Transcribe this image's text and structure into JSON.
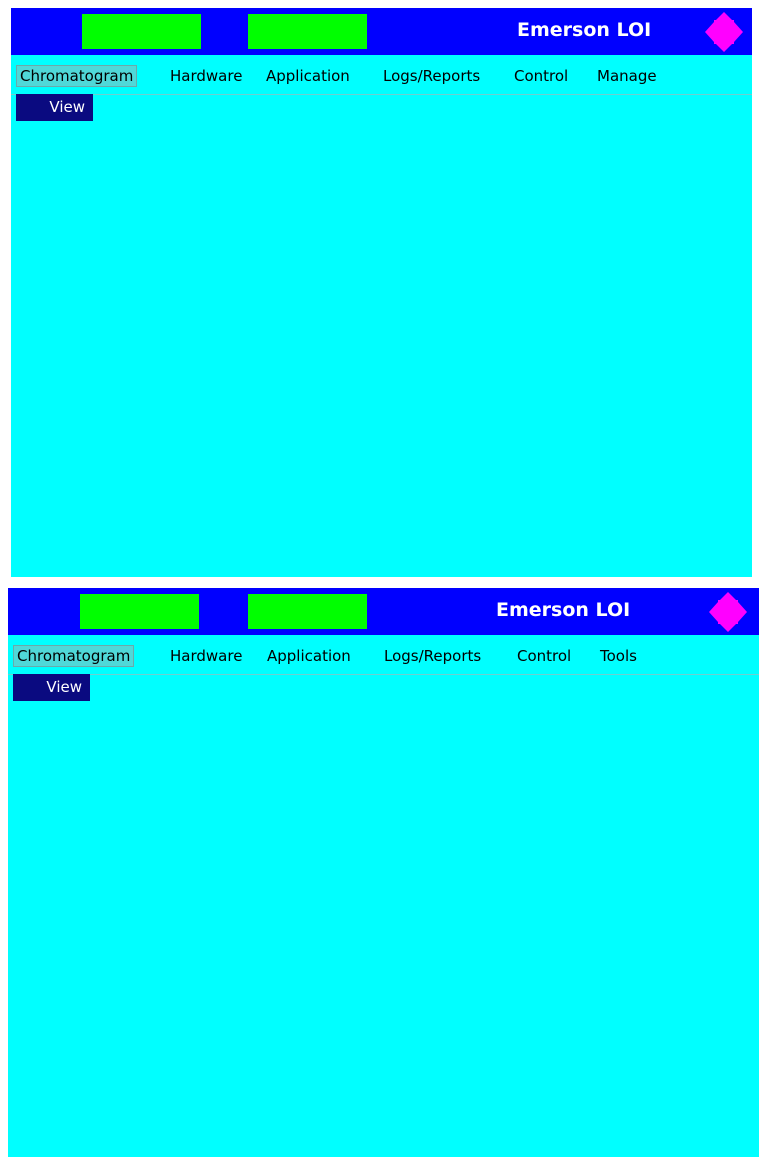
{
  "colors": {
    "background": "#00ffff",
    "titlebar": "#0000ff",
    "indicator": "#00ff00",
    "nav_icon": "#ff00ff",
    "submenu": "#0a0a80"
  },
  "screens": [
    {
      "title": "Emerson LOI",
      "menu": [
        "Chromatogram",
        "Hardware",
        "Application",
        "Logs/Reports",
        "Control",
        "Manage"
      ],
      "active_menu": "Chromatogram",
      "submenu": [
        "View"
      ]
    },
    {
      "title": "Emerson LOI",
      "menu": [
        "Chromatogram",
        "Hardware",
        "Application",
        "Logs/Reports",
        "Control",
        "Tools"
      ],
      "active_menu": "Chromatogram",
      "submenu": [
        "View"
      ]
    }
  ]
}
